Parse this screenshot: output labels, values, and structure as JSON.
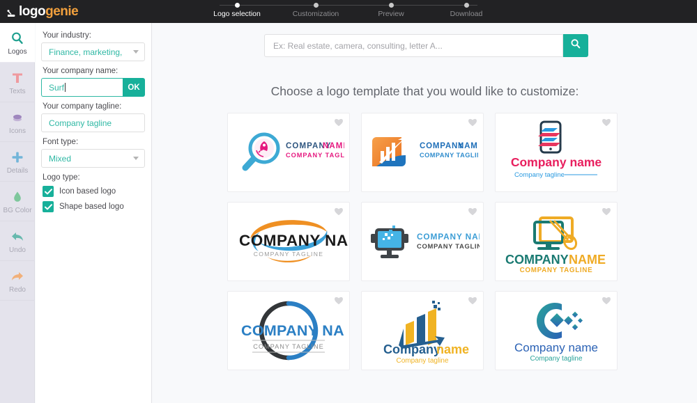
{
  "brand": {
    "part1": "logo",
    "part2": "genie",
    "mark_icon": "genie-lamp-icon"
  },
  "stepper": {
    "steps": [
      {
        "label": "Logo selection",
        "active": true
      },
      {
        "label": "Customization",
        "active": false
      },
      {
        "label": "Preview",
        "active": false
      },
      {
        "label": "Download",
        "active": false
      }
    ]
  },
  "rail": {
    "items": [
      {
        "label": "Logos",
        "icon": "search-icon",
        "active": true
      },
      {
        "label": "Texts",
        "icon": "text-t-icon",
        "active": false
      },
      {
        "label": "Icons",
        "icon": "layers-icon",
        "active": false
      },
      {
        "label": "Details",
        "icon": "plus-icon",
        "active": false
      },
      {
        "label": "BG Color",
        "icon": "droplet-icon",
        "active": false
      },
      {
        "label": "Undo",
        "icon": "undo-arrow-icon",
        "active": false
      },
      {
        "label": "Redo",
        "icon": "redo-arrow-icon",
        "active": false
      }
    ]
  },
  "panel": {
    "industry_label": "Your industry:",
    "industry_value": "Finance, marketing,",
    "company_name_label": "Your company name:",
    "company_name_value": "Surf",
    "ok_label": "OK",
    "tagline_label": "Your company tagline:",
    "tagline_placeholder": "Company tagline",
    "font_type_label": "Font type:",
    "font_type_value": "Mixed",
    "logo_type_label": "Logo type:",
    "checkboxes": [
      {
        "label": "Icon based logo",
        "checked": true
      },
      {
        "label": "Shape based logo",
        "checked": true
      }
    ]
  },
  "main": {
    "search_placeholder": "Ex: Real estate, camera, consulting, letter A...",
    "search_button_icon": "search-icon",
    "heading": "Choose a logo template that you would like to customize:",
    "favorite_icon": "heart-icon",
    "cards": [
      {
        "id": "magnifier-rocket",
        "name": "COMPANY NAME",
        "tagline": "COMPANY TAGLINE",
        "name_color": "#2f5680",
        "tagline_color": "#e5187f"
      },
      {
        "id": "bar-chart-arrow",
        "name": "COMPANY   NAME",
        "tagline": "COMPANY TAGLINE",
        "name_color": "#1f6fb8",
        "tagline_color": "#2f8ccd"
      },
      {
        "id": "smartphone-stripes",
        "name": "Company name",
        "tagline": "Company tagline",
        "name_color": "#e81f5e",
        "tagline_color": "#2a9ae0"
      },
      {
        "id": "swoosh-ellipse",
        "name": "COMPANY NA",
        "tagline": "COMPANY TAGLINE",
        "name_color": "#1b1b1b",
        "tagline_color": "#9a9a9a"
      },
      {
        "id": "monitor-pixels",
        "name": "COMPANY NAME",
        "tagline": "COMPANY TAGLINE",
        "name_color": "#3d9ed6",
        "tagline_color": "#4a4a4a"
      },
      {
        "id": "monitor-mouse",
        "name_part1": "COMPANY",
        "name_part2": "NAME",
        "tagline": "COMPANY TAGLINE",
        "name_color": "#1a7a72",
        "name2_color": "#efab25",
        "tagline_color": "#efab25"
      },
      {
        "id": "circle-arcs",
        "name": "COMPANY NA",
        "tagline": "COMPANY TAGLINE",
        "name_color": "#2b7fc4",
        "tagline_color": "#8d8d8d"
      },
      {
        "id": "bars-arrow-yellow",
        "name_part1": "Company",
        "name_part2": "name",
        "tagline": "Company tagline",
        "name_color": "#255f8f",
        "name2_color": "#f0b323",
        "tagline_color": "#f0b323"
      },
      {
        "id": "c-diamonds",
        "name": "Company name",
        "tagline": "Company tagline",
        "name_color": "#2b62b5",
        "tagline_color": "#2aa39a"
      }
    ]
  },
  "colors": {
    "accent_teal": "#17b09a",
    "brand_orange": "#f2a03d",
    "topbar_bg": "#222224",
    "rail_bg": "#e4e3ec",
    "main_bg": "#f8f9fb"
  }
}
